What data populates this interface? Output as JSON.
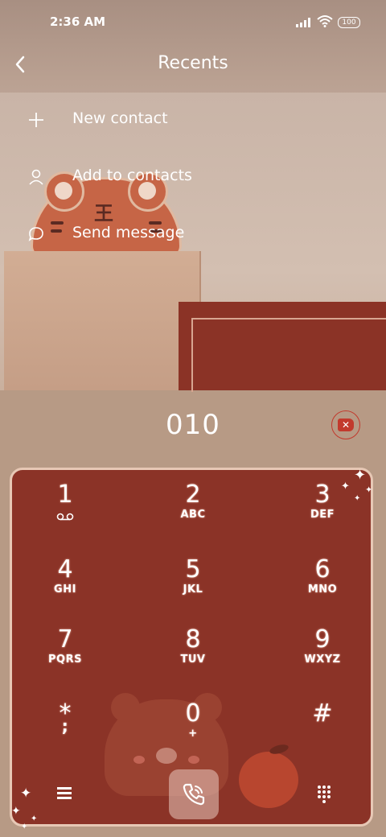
{
  "status_bar": {
    "time": "2:36 AM",
    "battery": "100"
  },
  "header": {
    "title": "Recents"
  },
  "menu": [
    {
      "label": "New contact",
      "icon": "plus-icon"
    },
    {
      "label": "Add to contacts",
      "icon": "person-icon"
    },
    {
      "label": "Send message",
      "icon": "message-icon"
    }
  ],
  "dialer": {
    "number": "010"
  },
  "keypad": [
    {
      "digit": "1",
      "letters": ""
    },
    {
      "digit": "2",
      "letters": "ABC"
    },
    {
      "digit": "3",
      "letters": "DEF"
    },
    {
      "digit": "4",
      "letters": "GHI"
    },
    {
      "digit": "5",
      "letters": "JKL"
    },
    {
      "digit": "6",
      "letters": "MNO"
    },
    {
      "digit": "7",
      "letters": "PQRS"
    },
    {
      "digit": "8",
      "letters": "TUV"
    },
    {
      "digit": "9",
      "letters": "WXYZ"
    },
    {
      "digit": "*",
      "letters": ";"
    },
    {
      "digit": "0",
      "letters": "+"
    },
    {
      "digit": "#",
      "letters": ""
    }
  ],
  "colors": {
    "keypad_bg": "#8b3327",
    "delete_accent": "#c23a2d",
    "text": "#ffffff"
  }
}
